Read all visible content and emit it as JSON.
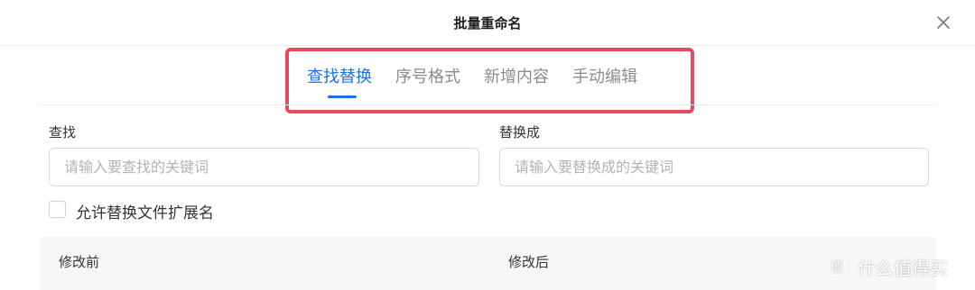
{
  "dialog": {
    "title": "批量重命名"
  },
  "tabs": [
    {
      "label": "查找替换",
      "active": true
    },
    {
      "label": "序号格式",
      "active": false
    },
    {
      "label": "新增内容",
      "active": false
    },
    {
      "label": "手动编辑",
      "active": false
    }
  ],
  "find": {
    "label": "查找",
    "placeholder": "请输入要查找的关键词",
    "value": ""
  },
  "replace": {
    "label": "替换成",
    "placeholder": "请输入要替换成的关键词",
    "value": ""
  },
  "options": {
    "allow_extension_label": "允许替换文件扩展名",
    "allow_extension_checked": false
  },
  "table": {
    "columns": [
      "修改前",
      "修改后"
    ]
  },
  "watermark": {
    "text": "什么值得买",
    "icon": "zhi-logo-icon"
  },
  "colors": {
    "accent": "#1e6ff1",
    "highlight": "#e8495e"
  }
}
